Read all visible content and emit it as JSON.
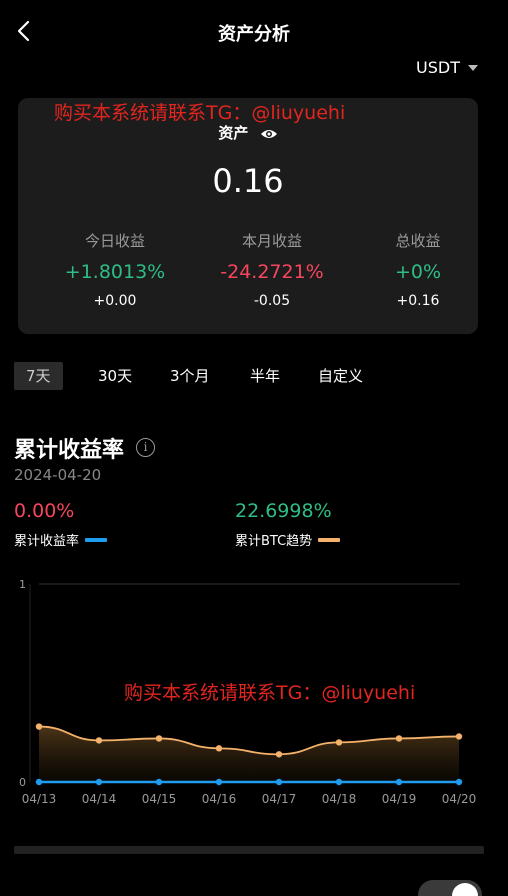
{
  "header": {
    "title": "资产分析"
  },
  "currency": {
    "selected": "USDT"
  },
  "watermark": {
    "text": "购买本系统请联系TG：@liuyuehi"
  },
  "asset": {
    "label": "资产",
    "value": "0.16",
    "stats": [
      {
        "label": "今日收益",
        "pct": "+1.8013%",
        "amount": "+0.00",
        "trend": "up"
      },
      {
        "label": "本月收益",
        "pct": "-24.2721%",
        "amount": "-0.05",
        "trend": "down"
      },
      {
        "label": "总收益",
        "pct": "+0%",
        "amount": "+0.16",
        "trend": "up"
      }
    ]
  },
  "periods": [
    "7天",
    "30天",
    "3个月",
    "半年",
    "自定义"
  ],
  "section": {
    "title": "累计收益率",
    "date": "2024-04-20",
    "metrics": [
      {
        "value": "0.00%",
        "name": "累计收益率",
        "color": "#f6465d",
        "legend_color": "#1e9cf0"
      },
      {
        "value": "22.6998%",
        "name": "累计BTC趋势",
        "color": "#2ebd85",
        "legend_color": "#f5b26b"
      }
    ]
  },
  "chart_data": {
    "type": "line",
    "categories": [
      "04/13",
      "04/14",
      "04/15",
      "04/16",
      "04/17",
      "04/18",
      "04/19",
      "04/20"
    ],
    "yticks": [
      "1",
      "0"
    ],
    "ylim": [
      0,
      1
    ],
    "series": [
      {
        "name": "累计收益率",
        "color": "#1e9cf0",
        "values": [
          0,
          0,
          0,
          0,
          0,
          0,
          0,
          0
        ]
      },
      {
        "name": "累计BTC趋势",
        "color": "#f5b26b",
        "values": [
          0.28,
          0.21,
          0.22,
          0.17,
          0.14,
          0.2,
          0.22,
          0.23
        ]
      }
    ]
  }
}
